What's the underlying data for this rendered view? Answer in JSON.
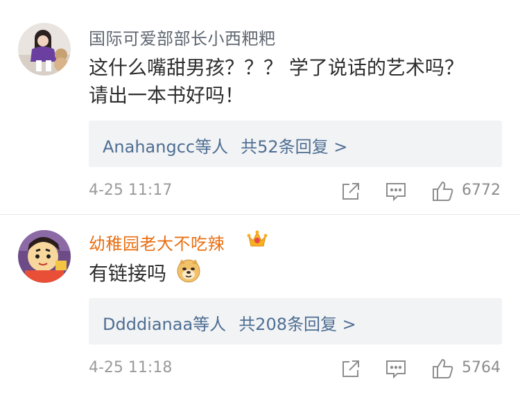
{
  "comments": [
    {
      "username": "国际可爱部部长小西粑粑",
      "content": "这什么嘴甜男孩？？？ 学了说话的艺术吗？\n请出一本书好吗！",
      "reply_users": "Anahangcc等人",
      "reply_count": "共52条回复 >",
      "time": "4-25 11:17",
      "likes": "6772"
    },
    {
      "username": "幼稚园老大不吃辣",
      "content": "有链接吗",
      "reply_users": "Ddddianaa等人",
      "reply_count": "共208条回复 >",
      "time": "4-25 11:18",
      "likes": "5764"
    }
  ],
  "colors": {
    "username_default": "#5f6670",
    "username_vip": "#e86f12",
    "link_blue": "#4e6e92",
    "reply_box_bg": "#f2f3f5",
    "meta_gray": "#9a9a9a"
  },
  "icons": {
    "share": "share-icon",
    "comment": "comment-icon",
    "like": "thumbs-up-icon",
    "vip": "vip-crown-badge",
    "emoji": "doge-emoji"
  }
}
